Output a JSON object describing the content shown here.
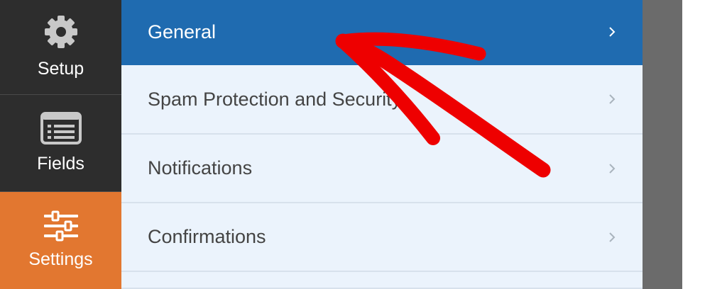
{
  "sidebar": {
    "items": [
      {
        "label": "Setup",
        "icon": "gear-icon",
        "active": false
      },
      {
        "label": "Fields",
        "icon": "fields-list-icon",
        "active": false
      },
      {
        "label": "Settings",
        "icon": "sliders-icon",
        "active": true
      }
    ]
  },
  "settings_panel": {
    "items": [
      {
        "label": "General",
        "active": true
      },
      {
        "label": "Spam Protection and Security",
        "active": false
      },
      {
        "label": "Notifications",
        "active": false
      },
      {
        "label": "Confirmations",
        "active": false
      },
      {
        "label": "",
        "active": false
      }
    ]
  },
  "annotation": {
    "icon": "red-arrow-annotation",
    "color": "#ee0000"
  },
  "colors": {
    "sidebar_bg": "#2d2d2d",
    "settings_active": "#e27730",
    "panel_active": "#1f6bb0",
    "panel_bg": "#ebf3fc"
  }
}
